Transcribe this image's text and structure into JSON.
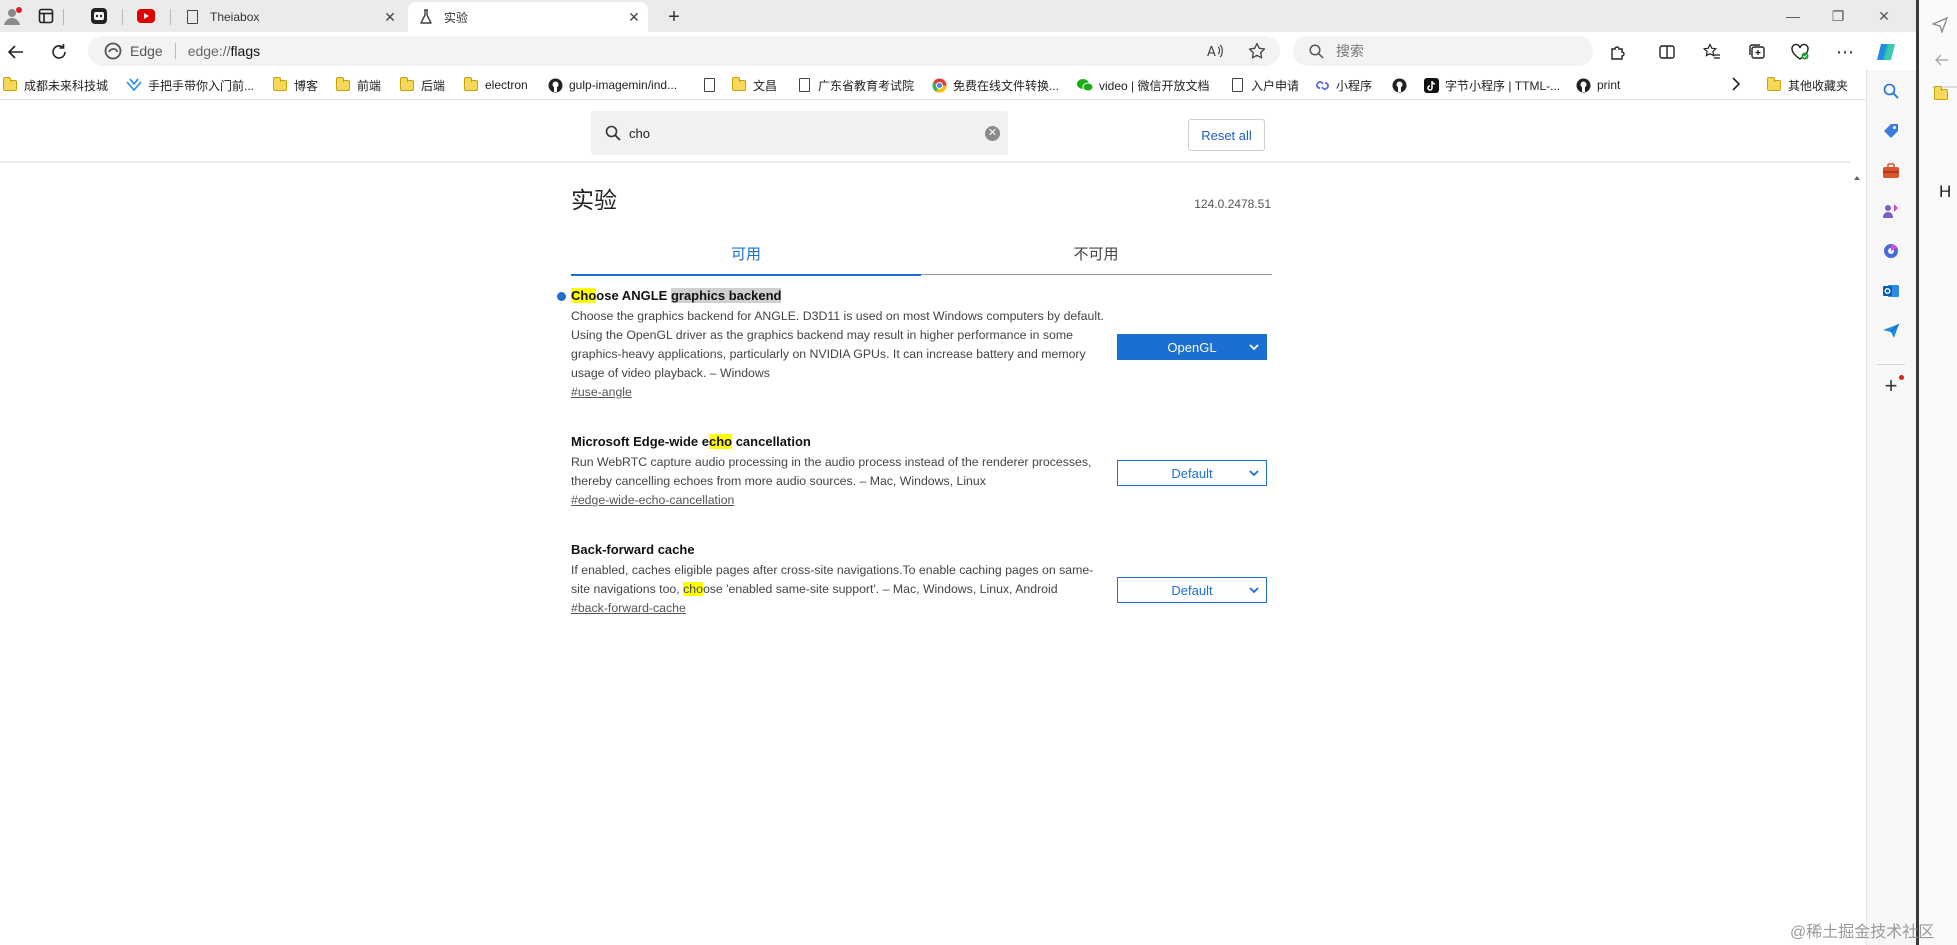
{
  "tabs": [
    {
      "title": "Theiabox"
    },
    {
      "title": "实验"
    }
  ],
  "address": {
    "brand": "Edge",
    "url_scheme": "edge://",
    "url_path": "flags"
  },
  "search": {
    "placeholder": "搜索"
  },
  "bookmarks": [
    {
      "label": "成都未来科技城",
      "icon": "folder-icon"
    },
    {
      "label": "手把手带你入门前...",
      "icon": "bookmark-icon"
    },
    {
      "label": "博客",
      "icon": "folder-icon"
    },
    {
      "label": "前端",
      "icon": "folder-icon"
    },
    {
      "label": "后端",
      "icon": "folder-icon"
    },
    {
      "label": "electron",
      "icon": "folder-icon"
    },
    {
      "label": "gulp-imagemin/ind...",
      "icon": "github-icon"
    },
    {
      "label": "",
      "icon": "document-icon"
    },
    {
      "label": "文昌",
      "icon": "folder-icon"
    },
    {
      "label": "广东省教育考试院",
      "icon": "document-icon"
    },
    {
      "label": "免费在线文件转换...",
      "icon": "chrome-icon"
    },
    {
      "label": "video | 微信开放文档",
      "icon": "wechat-icon"
    },
    {
      "label": "入户申请",
      "icon": "document-icon"
    },
    {
      "label": "小程序",
      "icon": "link-icon"
    },
    {
      "label": "",
      "icon": "github-icon"
    },
    {
      "label": "字节小程序 | TTML-...",
      "icon": "tiktok-icon"
    },
    {
      "label": "print",
      "icon": "github-icon"
    }
  ],
  "other_bookmarks": "其他收藏夹",
  "flags": {
    "search_value": "cho",
    "reset_label": "Reset all",
    "title": "实验",
    "version": "124.0.2478.51",
    "tab_available": "可用",
    "tab_unavailable": "不可用",
    "experiments": [
      {
        "name_hl": "Cho",
        "name_mid": "ose ANGLE ",
        "name_sel": "graphics backend",
        "description": "Choose the graphics backend for ANGLE. D3D11 is used on most Windows computers by default. Using the OpenGL driver as the graphics backend may result in higher performance in some graphics-heavy applications, particularly on NVIDIA GPUs. It can increase battery and memory usage of video playback. – Windows",
        "permalink": "#use-angle",
        "value": "OpenGL"
      },
      {
        "name_pre": "Microsoft Edge-wide e",
        "name_hl": "cho",
        "name_post": " cancellation",
        "description": "Run WebRTC capture audio processing in the audio process instead of the renderer processes, thereby cancelling echoes from more audio sources. – Mac, Windows, Linux",
        "permalink": "#edge-wide-echo-cancellation",
        "value": "Default"
      },
      {
        "name": "Back-forward cache",
        "desc_pre": "If enabled, caches eligible pages after cross-site navigations.To enable caching pages on same-site navigations too, ",
        "desc_hl": "cho",
        "desc_post": "ose 'enabled same-site support'. – Mac, Windows, Linux, Android",
        "permalink": "#back-forward-cache",
        "value": "Default"
      }
    ]
  },
  "rightpane_letter": "H",
  "watermark": "@稀土掘金技术社区",
  "colors": {
    "accent": "#1a6fd1",
    "highlight": "#ffff00"
  }
}
